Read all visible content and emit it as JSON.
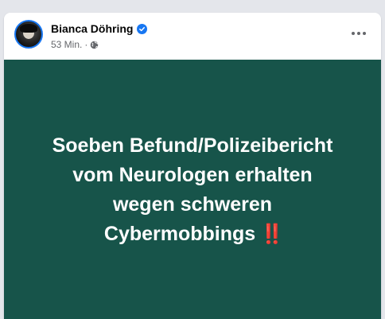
{
  "author": {
    "name": "Bianca Döhring",
    "verified": true
  },
  "post": {
    "timestamp": "53 Min.",
    "separator": "·",
    "audience_icon": "globe-icon",
    "more_icon": "more-options-icon",
    "background_color": "#17544a",
    "text_lines": [
      "Soeben Befund/Polizeibericht",
      "vom Neurologen erhalten",
      "wegen schweren",
      "Cybermobbings"
    ],
    "emoji": "‼️"
  }
}
